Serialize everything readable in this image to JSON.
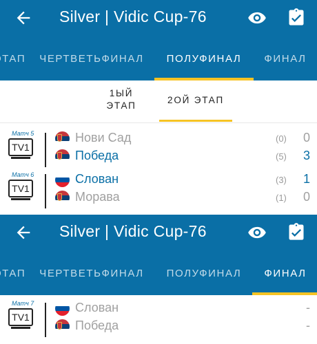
{
  "colors": {
    "primary": "#0a6fa6",
    "accent": "#f6c324",
    "muted": "#a0a0a0",
    "text": "#222222"
  },
  "screens": [
    {
      "app_bar": {
        "title": "Silver | Vidic Cup-76",
        "icons": [
          "back-arrow-icon",
          "eye-icon",
          "clipboard-check-icon"
        ]
      },
      "tabs": [
        "ЭТАП",
        "ЧЕРТВЕТЬФИНАЛ",
        "ПОЛУФИНАЛ",
        "ФИНАЛ"
      ],
      "selected_tab": "ПОЛУФИНАЛ",
      "subtabs": [
        "1ЫЙ ЭТАП",
        "2ОЙ ЭТАП"
      ],
      "subtab_lines": [
        [
          "1ЫЙ",
          "ЭТАП"
        ],
        [
          "2ОЙ ЭТАП"
        ]
      ],
      "selected_subtab": "2ОЙ ЭТАП",
      "matches": [
        {
          "label": "Матч 5",
          "tv": "TV1",
          "teams": [
            {
              "name": "Нови Сад",
              "flag": "serbia",
              "sub": "(0)",
              "score": "0",
              "winner": false
            },
            {
              "name": "Победа",
              "flag": "serbia",
              "sub": "(5)",
              "score": "3",
              "winner": true
            }
          ]
        },
        {
          "label": "Матч 6",
          "tv": "TV1",
          "teams": [
            {
              "name": "Слован",
              "flag": "slovenia",
              "sub": "(3)",
              "score": "1",
              "winner": true
            },
            {
              "name": "Морава",
              "flag": "serbia",
              "sub": "(1)",
              "score": "0",
              "winner": false
            }
          ]
        }
      ]
    },
    {
      "app_bar": {
        "title": "Silver | Vidic Cup-76",
        "icons": [
          "back-arrow-icon",
          "eye-icon",
          "clipboard-check-icon"
        ]
      },
      "tabs": [
        "ЭТАП",
        "ЧЕРТВЕТЬФИНАЛ",
        "ПОЛУФИНАЛ",
        "ФИНАЛ"
      ],
      "selected_tab": "ФИНАЛ",
      "matches": [
        {
          "label": "Матч 7",
          "tv": "TV1",
          "teams": [
            {
              "name": "Слован",
              "flag": "slovenia",
              "sub": "",
              "score": "-",
              "winner": false
            },
            {
              "name": "Победа",
              "flag": "serbia",
              "sub": "",
              "score": "-",
              "winner": false
            }
          ]
        }
      ]
    }
  ]
}
